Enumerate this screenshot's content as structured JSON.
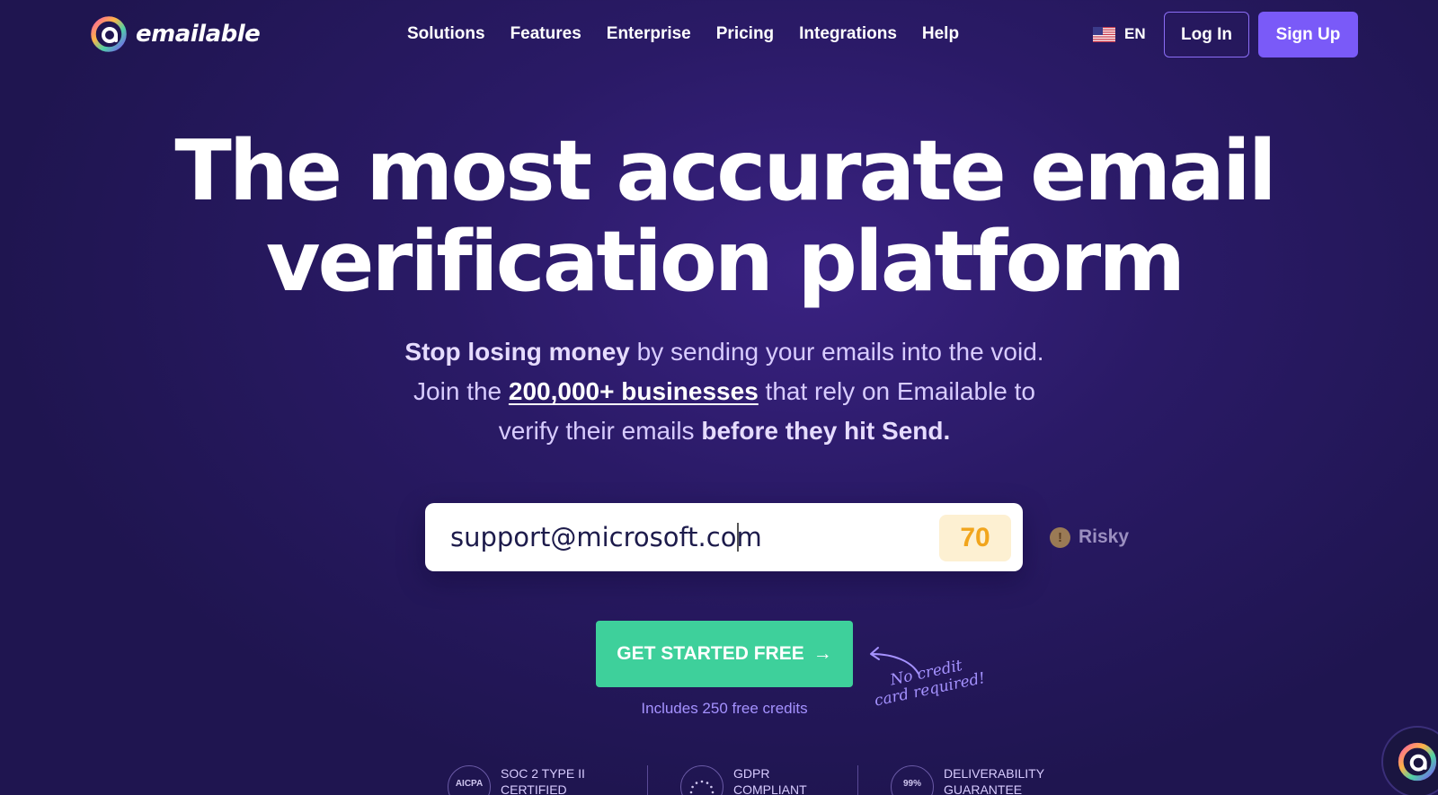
{
  "brand": {
    "name": "emailable"
  },
  "nav": {
    "items": [
      "Solutions",
      "Features",
      "Enterprise",
      "Pricing",
      "Integrations",
      "Help"
    ],
    "language": "EN",
    "login": "Log In",
    "signup": "Sign Up"
  },
  "hero": {
    "title_line1": "The most accurate email",
    "title_line2": "verification platform",
    "sub_bold1": "Stop losing money",
    "sub_text1": " by sending your emails into the void.",
    "sub_text2": "Join the ",
    "sub_link": "200,000+ businesses",
    "sub_text3": " that rely on Emailable to",
    "sub_text4": "verify their emails ",
    "sub_bold2": "before they hit Send."
  },
  "verifier": {
    "email_value": "support@microsoft.com",
    "score": "70",
    "status": "Risky",
    "status_symbol": "!",
    "colors": {
      "score_text": "#f1a51d",
      "score_bg": "#fdf0d2"
    }
  },
  "cta": {
    "label": "GET STARTED FREE",
    "arrow": "→",
    "credits": "Includes 250 free credits",
    "note_line1": "No credit",
    "note_line2": "card required!"
  },
  "badges": [
    {
      "icon_text": "AICPA",
      "line1": "SOC 2 TYPE II",
      "line2": "CERTIFIED"
    },
    {
      "icon_text": "",
      "line1": "GDPR",
      "line2": "COMPLIANT"
    },
    {
      "icon_text": "99%",
      "line1": "DELIVERABILITY",
      "line2": "GUARANTEE"
    }
  ],
  "colors": {
    "accent": "#7a5af8",
    "cta": "#3ed09b",
    "background": "#2a1a66"
  }
}
